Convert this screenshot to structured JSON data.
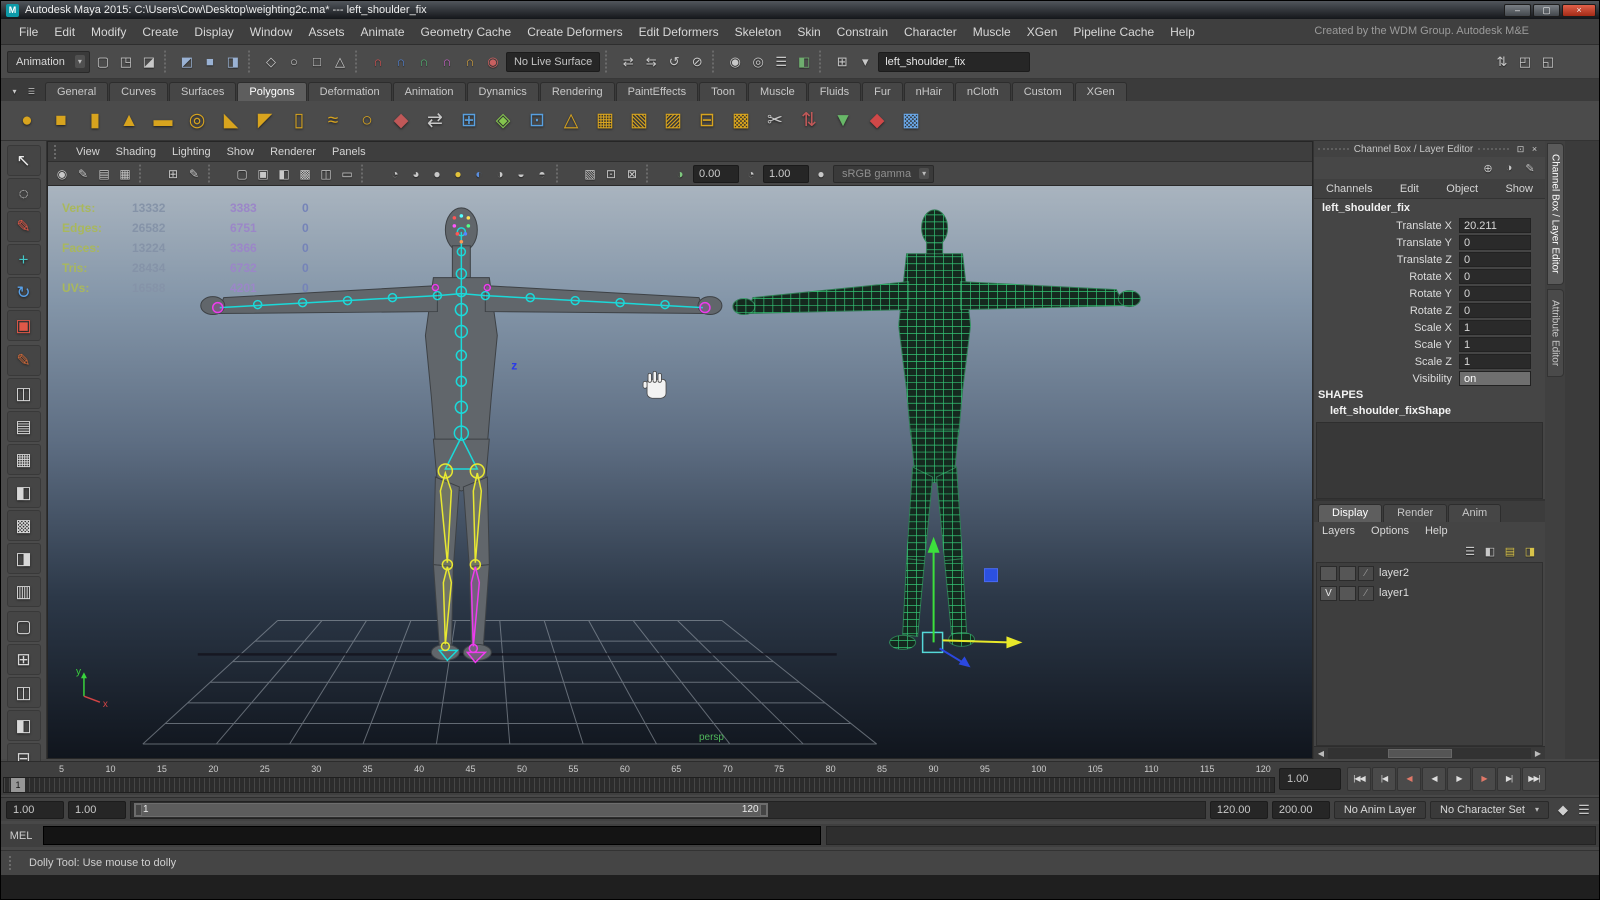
{
  "window": {
    "title": "Autodesk Maya 2015: C:\\Users\\Cow\\Desktop\\weighting2c.ma*   ---   left_shoulder_fix",
    "credit": "Created by the WDM Group. Autodesk M&E",
    "app_initial": "M",
    "minimize": "–",
    "maximize": "▢",
    "close": "×"
  },
  "menubar": {
    "items": [
      "File",
      "Edit",
      "Modify",
      "Create",
      "Display",
      "Window",
      "Assets",
      "Animate",
      "Geometry Cache",
      "Create Deformers",
      "Edit Deformers",
      "Skeleton",
      "Skin",
      "Constrain",
      "Character",
      "Muscle",
      "XGen",
      "Pipeline Cache",
      "Help"
    ]
  },
  "statusline": {
    "mode": "Animation",
    "mode_arrow": "▾",
    "icons_left": [
      {
        "name": "new-scene-icon",
        "glyph": "▢"
      },
      {
        "name": "open-scene-icon",
        "glyph": "◳"
      },
      {
        "name": "save-scene-icon",
        "glyph": "◪"
      },
      {
        "sep": true
      },
      {
        "name": "select-by-hierarchy-icon",
        "glyph": "◩",
        "color": "#9ab2d4"
      },
      {
        "name": "select-by-object-icon",
        "glyph": "■",
        "color": "#9ab2d4"
      },
      {
        "name": "select-by-component-icon",
        "glyph": "◨",
        "color": "#9ab2d4"
      },
      {
        "sep": true
      },
      {
        "name": "mask-points-icon",
        "glyph": "◇"
      },
      {
        "name": "mask-curves-icon",
        "glyph": "○"
      },
      {
        "name": "mask-surfaces-icon",
        "glyph": "□"
      },
      {
        "name": "mask-deformers-icon",
        "glyph": "△"
      },
      {
        "sep": true
      },
      {
        "name": "snap-to-grid-icon",
        "glyph": "∩",
        "color": "#d05050"
      },
      {
        "name": "snap-to-curve-icon",
        "glyph": "∩",
        "color": "#5080d0"
      },
      {
        "name": "snap-to-point-icon",
        "glyph": "∩",
        "color": "#50b070"
      },
      {
        "name": "snap-to-projected-center-icon",
        "glyph": "∩",
        "color": "#c060c0"
      },
      {
        "name": "snap-to-view-plane-icon",
        "glyph": "∩",
        "color": "#d0a040"
      },
      {
        "name": "make-live-icon",
        "glyph": "◉",
        "color": "#c86060"
      }
    ],
    "live_surface": "No Live Surface",
    "icons_mid": [
      {
        "sep": true
      },
      {
        "name": "input-connections-icon",
        "glyph": "⇄"
      },
      {
        "name": "output-connections-icon",
        "glyph": "⇆"
      },
      {
        "name": "construction-history-icon",
        "glyph": "↺"
      },
      {
        "name": "no-history-icon",
        "glyph": "⊘"
      },
      {
        "sep": true
      },
      {
        "name": "render-current-frame-icon",
        "glyph": "◉"
      },
      {
        "name": "ipr-render-icon",
        "glyph": "◎"
      },
      {
        "name": "render-settings-icon",
        "glyph": "☰"
      },
      {
        "name": "hypershade-icon",
        "glyph": "◧",
        "color": "#6fae6f"
      },
      {
        "sep": true
      },
      {
        "name": "quick-field-mode-icon",
        "glyph": "⊞"
      },
      {
        "name": "field-dropdown-icon",
        "glyph": "▾"
      }
    ],
    "name_field": "left_shoulder_fix",
    "icons_right": [
      {
        "name": "show-sort-icon",
        "glyph": "⇅"
      },
      {
        "name": "toggle-modeling-toolkit-icon",
        "glyph": "◰"
      },
      {
        "name": "toggle-attr-editor-icon",
        "glyph": "◱"
      }
    ]
  },
  "shelf": {
    "menu_icons": [
      {
        "name": "shelf-tab-menu-icon",
        "glyph": "▾"
      },
      {
        "name": "shelf-options-icon",
        "glyph": "☰"
      }
    ],
    "tabs": [
      {
        "label": "General"
      },
      {
        "label": "Curves"
      },
      {
        "label": "Surfaces"
      },
      {
        "label": "Polygons",
        "active": true
      },
      {
        "label": "Deformation"
      },
      {
        "label": "Animation"
      },
      {
        "label": "Dynamics"
      },
      {
        "label": "Rendering"
      },
      {
        "label": "PaintEffects"
      },
      {
        "label": "Toon"
      },
      {
        "label": "Muscle"
      },
      {
        "label": "Fluids"
      },
      {
        "label": "Fur"
      },
      {
        "label": "nHair"
      },
      {
        "label": "nCloth"
      },
      {
        "label": "Custom"
      },
      {
        "label": "XGen"
      }
    ],
    "icons": [
      {
        "name": "shelf-poly-sphere",
        "glyph": "●",
        "color": "#d8a41e"
      },
      {
        "name": "shelf-poly-cube",
        "glyph": "■",
        "color": "#d8a41e"
      },
      {
        "name": "shelf-poly-cylinder",
        "glyph": "▮",
        "color": "#d8a41e"
      },
      {
        "name": "shelf-poly-cone",
        "glyph": "▲",
        "color": "#d8a41e"
      },
      {
        "name": "shelf-poly-plane",
        "glyph": "▬",
        "color": "#d8a41e"
      },
      {
        "name": "shelf-poly-torus",
        "glyph": "◎",
        "color": "#d8a41e"
      },
      {
        "name": "shelf-poly-prism",
        "glyph": "◣",
        "color": "#d8a41e"
      },
      {
        "name": "shelf-poly-pyramid",
        "glyph": "◤",
        "color": "#d8a41e"
      },
      {
        "name": "shelf-poly-pipe",
        "glyph": "▯",
        "color": "#d8a41e"
      },
      {
        "name": "shelf-poly-helix",
        "glyph": "≈",
        "color": "#d8a41e"
      },
      {
        "name": "shelf-poly-soccer-ball",
        "glyph": "○",
        "color": "#d8a41e"
      },
      {
        "name": "shelf-sculpt-tool",
        "glyph": "◆",
        "color": "#c05858"
      },
      {
        "name": "shelf-mirror",
        "glyph": "⇄",
        "color": "#c8c8c8"
      },
      {
        "name": "shelf-interactive-cube",
        "glyph": "⊞",
        "color": "#58a0e0"
      },
      {
        "name": "shelf-smooth",
        "glyph": "◈",
        "color": "#84c44e"
      },
      {
        "name": "shelf-subdiv-proxy",
        "glyph": "⊡",
        "color": "#58a0e0"
      },
      {
        "name": "shelf-triangulate",
        "glyph": "△",
        "color": "#d8a41e"
      },
      {
        "name": "shelf-quadrangulate",
        "glyph": "▦",
        "color": "#d8a41e"
      },
      {
        "name": "shelf-poly-extrude",
        "glyph": "▧",
        "color": "#d8a41e"
      },
      {
        "name": "shelf-poly-bevel",
        "glyph": "▨",
        "color": "#d8a41e"
      },
      {
        "name": "shelf-poly-bridge",
        "glyph": "⊟",
        "color": "#d8a41e"
      },
      {
        "name": "shelf-merge-verts",
        "glyph": "▩",
        "color": "#d8a41e"
      },
      {
        "name": "shelf-split-tool",
        "glyph": "✂",
        "color": "#c8c8c8"
      },
      {
        "name": "shelf-insert-edge-loop",
        "glyph": "⇅",
        "color": "#c05858"
      },
      {
        "name": "shelf-append-poly",
        "glyph": "▼",
        "color": "#68b868"
      },
      {
        "name": "shelf-crease-tool",
        "glyph": "◆",
        "color": "#d04848"
      },
      {
        "name": "shelf-uv-checker",
        "glyph": "▩",
        "color": "#6aa8e8"
      }
    ]
  },
  "toolbox": {
    "tools": [
      {
        "name": "select-tool",
        "glyph": "↖",
        "color": "#ececec"
      },
      {
        "name": "lasso-select-tool",
        "glyph": "◌",
        "color": "#d8d8d8"
      },
      {
        "name": "paint-select-tool",
        "glyph": "✎",
        "color": "#e05848"
      },
      {
        "name": "move-tool",
        "glyph": "+",
        "color": "#44c8c8"
      },
      {
        "name": "rotate-tool",
        "glyph": "↻",
        "color": "#58a0e8"
      },
      {
        "name": "scale-tool",
        "glyph": "▣",
        "color": "#e05848"
      }
    ],
    "extras": [
      {
        "name": "current-tool-paint-weights",
        "glyph": "✎",
        "color": "#d06a3a"
      },
      {
        "name": "symmetry-tool-icon",
        "glyph": "◫"
      },
      {
        "name": "toolbox-grid-a-icon",
        "glyph": "▤"
      },
      {
        "name": "toolbox-grid-b-icon",
        "glyph": "▦"
      },
      {
        "name": "toolbox-grid-c-icon",
        "glyph": "◧"
      },
      {
        "name": "toolbox-grid-d-icon",
        "glyph": "▩"
      },
      {
        "name": "toolbox-grid-e-icon",
        "glyph": "◨"
      },
      {
        "name": "toolbox-grid-f-icon",
        "glyph": "▥"
      }
    ],
    "layouts": [
      {
        "name": "layout-single-pane",
        "glyph": "▢"
      },
      {
        "name": "layout-four-pane",
        "glyph": "⊞"
      },
      {
        "name": "layout-two-pane-side",
        "glyph": "◫"
      },
      {
        "name": "layout-persp-outliner",
        "glyph": "◧"
      },
      {
        "name": "layout-hypergraph",
        "glyph": "⊟"
      }
    ]
  },
  "panel": {
    "menus": [
      "View",
      "Shading",
      "Lighting",
      "Show",
      "Renderer",
      "Panels"
    ],
    "toolbar": [
      {
        "name": "select-camera-icon",
        "glyph": "◉"
      },
      {
        "name": "camera-attributes-icon",
        "glyph": "✎"
      },
      {
        "name": "bookmarks-icon",
        "glyph": "▤"
      },
      {
        "name": "image-plane-icon",
        "glyph": "▦"
      },
      {
        "sep": true
      },
      {
        "name": "2d-pan-zoom-icon",
        "glyph": "⊞"
      },
      {
        "name": "grease-pencil-icon",
        "glyph": "✎"
      },
      {
        "sep": true
      },
      {
        "name": "film-gate-icon",
        "glyph": "▢"
      },
      {
        "name": "resolution-gate-icon",
        "glyph": "▣"
      },
      {
        "name": "gate-mask-icon",
        "glyph": "◧"
      },
      {
        "name": "field-chart-icon",
        "glyph": "▩"
      },
      {
        "name": "safe-action-icon",
        "glyph": "◫"
      },
      {
        "name": "safe-title-icon",
        "glyph": "▭"
      },
      {
        "sep": true
      },
      {
        "name": "wireframe-icon",
        "glyph": "◔"
      },
      {
        "name": "shaded-icon",
        "glyph": "◕"
      },
      {
        "name": "textured-icon",
        "glyph": "●"
      },
      {
        "name": "use-all-lights-icon",
        "glyph": "●",
        "color": "#e2c23a"
      },
      {
        "name": "shadows-icon",
        "glyph": "◐",
        "color": "#5a8ede"
      },
      {
        "name": "screen-ao-icon",
        "glyph": "◑"
      },
      {
        "name": "motion-blur-icon",
        "glyph": "◒"
      },
      {
        "name": "multisample-icon",
        "glyph": "◓"
      },
      {
        "sep": true
      },
      {
        "name": "xray-icon",
        "glyph": "▧"
      },
      {
        "name": "isolate-select-icon",
        "glyph": "⊡"
      },
      {
        "name": "plugin-shading-icon",
        "glyph": "⊠"
      },
      {
        "sep": true
      },
      {
        "name": "exposure-icon",
        "glyph": "◑",
        "color": "#7ec87e"
      }
    ],
    "exposure": "0.00",
    "contrast_icon": "◔",
    "gamma": "1.00",
    "lut_icon": "●",
    "colorspace": "sRGB gamma",
    "colorspace_arrow": "▾",
    "hud_rows": [
      {
        "label": "Verts:",
        "v1": "13332",
        "v2": "3383",
        "v3": "0"
      },
      {
        "label": "Edges:",
        "v1": "26582",
        "v2": "6751",
        "v3": "0"
      },
      {
        "label": "Faces:",
        "v1": "13224",
        "v2": "3366",
        "v3": "0"
      },
      {
        "label": "Tris:",
        "v1": "28434",
        "v2": "6732",
        "v3": "0"
      },
      {
        "label": "UVs:",
        "v1": "16588",
        "v2": "4201",
        "v3": "0"
      }
    ],
    "camera_label": "persp",
    "axis_y": "y",
    "axis_x": "x",
    "z_label": "z"
  },
  "channel_box": {
    "panel_title": "Channel Box / Layer Editor",
    "panel_icons": [
      {
        "name": "pop-out-panel-icon",
        "glyph": "⊡"
      },
      {
        "name": "close-panel-icon",
        "glyph": "×"
      }
    ],
    "tool_icons": [
      {
        "name": "manip-speed-icon",
        "glyph": "⊕"
      },
      {
        "name": "hybrid-display-icon",
        "glyph": "◑"
      },
      {
        "name": "channel-edit-icon",
        "glyph": "✎"
      }
    ],
    "menus": [
      "Channels",
      "Edit",
      "Object",
      "Show"
    ],
    "object_name": "left_shoulder_fix",
    "attributes": [
      {
        "name": "Translate X",
        "value": "20.211"
      },
      {
        "name": "Translate Y",
        "value": "0"
      },
      {
        "name": "Translate Z",
        "value": "0"
      },
      {
        "name": "Rotate X",
        "value": "0"
      },
      {
        "name": "Rotate Y",
        "value": "0"
      },
      {
        "name": "Rotate Z",
        "value": "0"
      },
      {
        "name": "Scale X",
        "value": "1"
      },
      {
        "name": "Scale Y",
        "value": "1"
      },
      {
        "name": "Scale Z",
        "value": "1"
      },
      {
        "name": "Visibility",
        "value": "on",
        "selected": true
      }
    ],
    "shapes_header": "SHAPES",
    "shape_name": "left_shoulder_fixShape"
  },
  "layer_editor": {
    "tabs": [
      {
        "label": "Display",
        "active": true
      },
      {
        "label": "Render"
      },
      {
        "label": "Anim"
      }
    ],
    "menus": [
      "Layers",
      "Options",
      "Help"
    ],
    "icons": [
      {
        "name": "layer-list-icon",
        "glyph": "☰"
      },
      {
        "name": "layer-visibility-icon",
        "glyph": "◧"
      },
      {
        "name": "new-empty-layer-icon",
        "glyph": "▤",
        "color": "#d8c34a"
      },
      {
        "name": "new-layer-from-selected-icon",
        "glyph": "◨",
        "color": "#d8c34a"
      }
    ],
    "layers": [
      {
        "name": "layer-row-layer2",
        "vis": "",
        "swatch": "∕",
        "label": "layer2"
      },
      {
        "name": "layer-row-layer1",
        "vis": "V",
        "swatch": "∕",
        "label": "layer1"
      }
    ],
    "scroll_left": "◀",
    "scroll_right": "▶"
  },
  "right_tabs": [
    {
      "label": "Channel Box / Layer Editor",
      "active": true
    },
    {
      "label": "Attribute Editor"
    }
  ],
  "timeline": {
    "ticks": [
      "5",
      "10",
      "15",
      "20",
      "25",
      "30",
      "35",
      "40",
      "45",
      "50",
      "55",
      "60",
      "65",
      "70",
      "75",
      "80",
      "85",
      "90",
      "95",
      "100",
      "105",
      "110",
      "115",
      "120"
    ],
    "current_frame": "1",
    "current_time": "1.00",
    "playback": [
      {
        "name": "go-to-start-button",
        "glyph": "|◀◀"
      },
      {
        "name": "step-back-frame-button",
        "glyph": "|◀"
      },
      {
        "name": "step-back-key-button",
        "glyph": "◀",
        "color": "#e07868"
      },
      {
        "name": "play-backwards-button",
        "glyph": "◀"
      },
      {
        "name": "play-forwards-button",
        "glyph": "▶"
      },
      {
        "name": "step-forward-key-button",
        "glyph": "▶",
        "color": "#e07868"
      },
      {
        "name": "step-forward-frame-button",
        "glyph": "▶|"
      },
      {
        "name": "go-to-end-button",
        "glyph": "▶▶|"
      }
    ]
  },
  "range": {
    "anim_start": "1.00",
    "play_start": "1.00",
    "inner_start": "1",
    "inner_end": "120",
    "play_end": "120.00",
    "anim_end": "200.00",
    "anim_layer": "No Anim Layer",
    "character_set": "No Character Set",
    "char_arrow": "▾",
    "icons": [
      {
        "name": "auto-keyframe-icon",
        "glyph": "◆",
        "color": "#cfcfcf"
      },
      {
        "name": "anim-preferences-icon",
        "glyph": "☰"
      }
    ]
  },
  "command_line": {
    "label": "MEL"
  },
  "help_line": {
    "text": "Dolly Tool: Use mouse to dolly"
  }
}
